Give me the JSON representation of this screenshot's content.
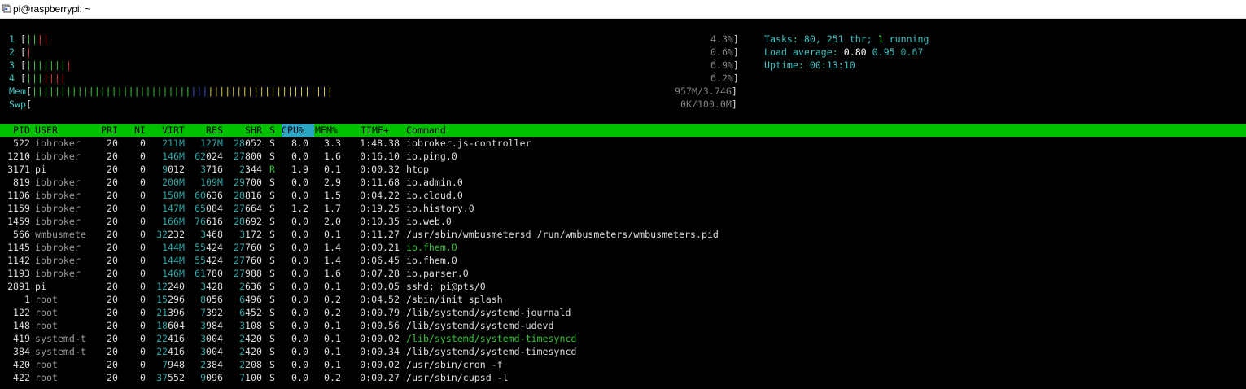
{
  "window": {
    "title": "pi@raspberrypi: ~"
  },
  "meters": {
    "cpus": [
      {
        "label": "1",
        "bars": "||||",
        "percent": "4.3%"
      },
      {
        "label": "2",
        "bars": "|",
        "percent": "0.6%"
      },
      {
        "label": "3",
        "bars": "||||||||",
        "percent": "6.9%"
      },
      {
        "label": "4",
        "bars": "|||||||",
        "percent": "6.2%"
      }
    ],
    "mem": {
      "label": "Mem",
      "used_bars": "||||||||||||||||||||||||||||",
      "buffer_bars": "|||",
      "cache_bars": "||||||||||||||||||||||",
      "value": "957M/3.74G"
    },
    "swp": {
      "label": "Swp",
      "value": "0K/100.0M"
    }
  },
  "summary": {
    "tasks_label": "Tasks:",
    "tasks_value": "80,",
    "thr_value": "251",
    "thr_label": "thr;",
    "running_value": "1",
    "running_label": "running",
    "load_label": "Load average:",
    "load1": "0.80",
    "load5": "0.95",
    "load15": "0.67",
    "uptime_label": "Uptime:",
    "uptime_value": "00:13:10"
  },
  "table": {
    "headers": [
      "PID",
      "USER",
      "PRI",
      "NI",
      "VIRT",
      "RES",
      "SHR",
      "S",
      "CPU%",
      "MEM%",
      "TIME+",
      "Command"
    ],
    "sorted_column": "CPU%",
    "rows": [
      {
        "pid": "522",
        "user": "iobroker",
        "pri": "20",
        "ni": "0",
        "virt": "211M",
        "res": "127M",
        "shr": "28052",
        "s": "S",
        "cpu": "8.0",
        "mem": "3.3",
        "time": "1:48.38",
        "command": "iobroker.js-controller"
      },
      {
        "pid": "1210",
        "user": "iobroker",
        "pri": "20",
        "ni": "0",
        "virt": "146M",
        "res": "62024",
        "shr": "27800",
        "s": "S",
        "cpu": "0.0",
        "mem": "1.6",
        "time": "0:16.10",
        "command": "io.ping.0"
      },
      {
        "pid": "3171",
        "user": "pi",
        "pri": "20",
        "ni": "0",
        "virt": "9012",
        "res": "3716",
        "shr": "2344",
        "s": "R",
        "cpu": "1.9",
        "mem": "0.1",
        "time": "0:00.32",
        "command": "htop"
      },
      {
        "pid": "819",
        "user": "iobroker",
        "pri": "20",
        "ni": "0",
        "virt": "200M",
        "res": "109M",
        "shr": "29700",
        "s": "S",
        "cpu": "0.0",
        "mem": "2.9",
        "time": "0:11.68",
        "command": "io.admin.0"
      },
      {
        "pid": "1106",
        "user": "iobroker",
        "pri": "20",
        "ni": "0",
        "virt": "150M",
        "res": "60636",
        "shr": "28816",
        "s": "S",
        "cpu": "0.0",
        "mem": "1.5",
        "time": "0:04.22",
        "command": "io.cloud.0"
      },
      {
        "pid": "1159",
        "user": "iobroker",
        "pri": "20",
        "ni": "0",
        "virt": "147M",
        "res": "65084",
        "shr": "27664",
        "s": "S",
        "cpu": "1.2",
        "mem": "1.7",
        "time": "0:19.25",
        "command": "io.history.0"
      },
      {
        "pid": "1459",
        "user": "iobroker",
        "pri": "20",
        "ni": "0",
        "virt": "166M",
        "res": "76616",
        "shr": "28692",
        "s": "S",
        "cpu": "0.0",
        "mem": "2.0",
        "time": "0:10.35",
        "command": "io.web.0"
      },
      {
        "pid": "566",
        "user": "wmbusmete",
        "pri": "20",
        "ni": "0",
        "virt": "32232",
        "res": "3468",
        "shr": "3172",
        "s": "S",
        "cpu": "0.0",
        "mem": "0.1",
        "time": "0:11.27",
        "command": "/usr/sbin/wmbusmetersd /run/wmbusmeters/wmbusmeters.pid"
      },
      {
        "pid": "1145",
        "user": "iobroker",
        "pri": "20",
        "ni": "0",
        "virt": "144M",
        "res": "55424",
        "shr": "27760",
        "s": "S",
        "cpu": "0.0",
        "mem": "1.4",
        "time": "0:00.21",
        "command": "io.fhem.0",
        "thread": true
      },
      {
        "pid": "1142",
        "user": "iobroker",
        "pri": "20",
        "ni": "0",
        "virt": "144M",
        "res": "55424",
        "shr": "27760",
        "s": "S",
        "cpu": "0.0",
        "mem": "1.4",
        "time": "0:06.45",
        "command": "io.fhem.0"
      },
      {
        "pid": "1193",
        "user": "iobroker",
        "pri": "20",
        "ni": "0",
        "virt": "146M",
        "res": "61780",
        "shr": "27988",
        "s": "S",
        "cpu": "0.0",
        "mem": "1.6",
        "time": "0:07.28",
        "command": "io.parser.0"
      },
      {
        "pid": "2891",
        "user": "pi",
        "pri": "20",
        "ni": "0",
        "virt": "12240",
        "res": "3428",
        "shr": "2636",
        "s": "S",
        "cpu": "0.0",
        "mem": "0.1",
        "time": "0:00.05",
        "command": "sshd: pi@pts/0"
      },
      {
        "pid": "1",
        "user": "root",
        "pri": "20",
        "ni": "0",
        "virt": "15296",
        "res": "8056",
        "shr": "6496",
        "s": "S",
        "cpu": "0.0",
        "mem": "0.2",
        "time": "0:04.52",
        "command": "/sbin/init splash"
      },
      {
        "pid": "122",
        "user": "root",
        "pri": "20",
        "ni": "0",
        "virt": "21396",
        "res": "7392",
        "shr": "6452",
        "s": "S",
        "cpu": "0.0",
        "mem": "0.2",
        "time": "0:00.79",
        "command": "/lib/systemd/systemd-journald"
      },
      {
        "pid": "148",
        "user": "root",
        "pri": "20",
        "ni": "0",
        "virt": "18604",
        "res": "3984",
        "shr": "3108",
        "s": "S",
        "cpu": "0.0",
        "mem": "0.1",
        "time": "0:00.56",
        "command": "/lib/systemd/systemd-udevd"
      },
      {
        "pid": "419",
        "user": "systemd-t",
        "pri": "20",
        "ni": "0",
        "virt": "22416",
        "res": "3004",
        "shr": "2420",
        "s": "S",
        "cpu": "0.0",
        "mem": "0.1",
        "time": "0:00.02",
        "command": "/lib/systemd/systemd-timesyncd",
        "thread": true
      },
      {
        "pid": "384",
        "user": "systemd-t",
        "pri": "20",
        "ni": "0",
        "virt": "22416",
        "res": "3004",
        "shr": "2420",
        "s": "S",
        "cpu": "0.0",
        "mem": "0.1",
        "time": "0:00.34",
        "command": "/lib/systemd/systemd-timesyncd"
      },
      {
        "pid": "420",
        "user": "root",
        "pri": "20",
        "ni": "0",
        "virt": "7948",
        "res": "2384",
        "shr": "2208",
        "s": "S",
        "cpu": "0.0",
        "mem": "0.1",
        "time": "0:00.02",
        "command": "/usr/sbin/cron -f"
      },
      {
        "pid": "422",
        "user": "root",
        "pri": "20",
        "ni": "0",
        "virt": "37552",
        "res": "9096",
        "shr": "7100",
        "s": "S",
        "cpu": "0.0",
        "mem": "0.2",
        "time": "0:00.27",
        "command": "/usr/sbin/cupsd -l"
      }
    ]
  }
}
